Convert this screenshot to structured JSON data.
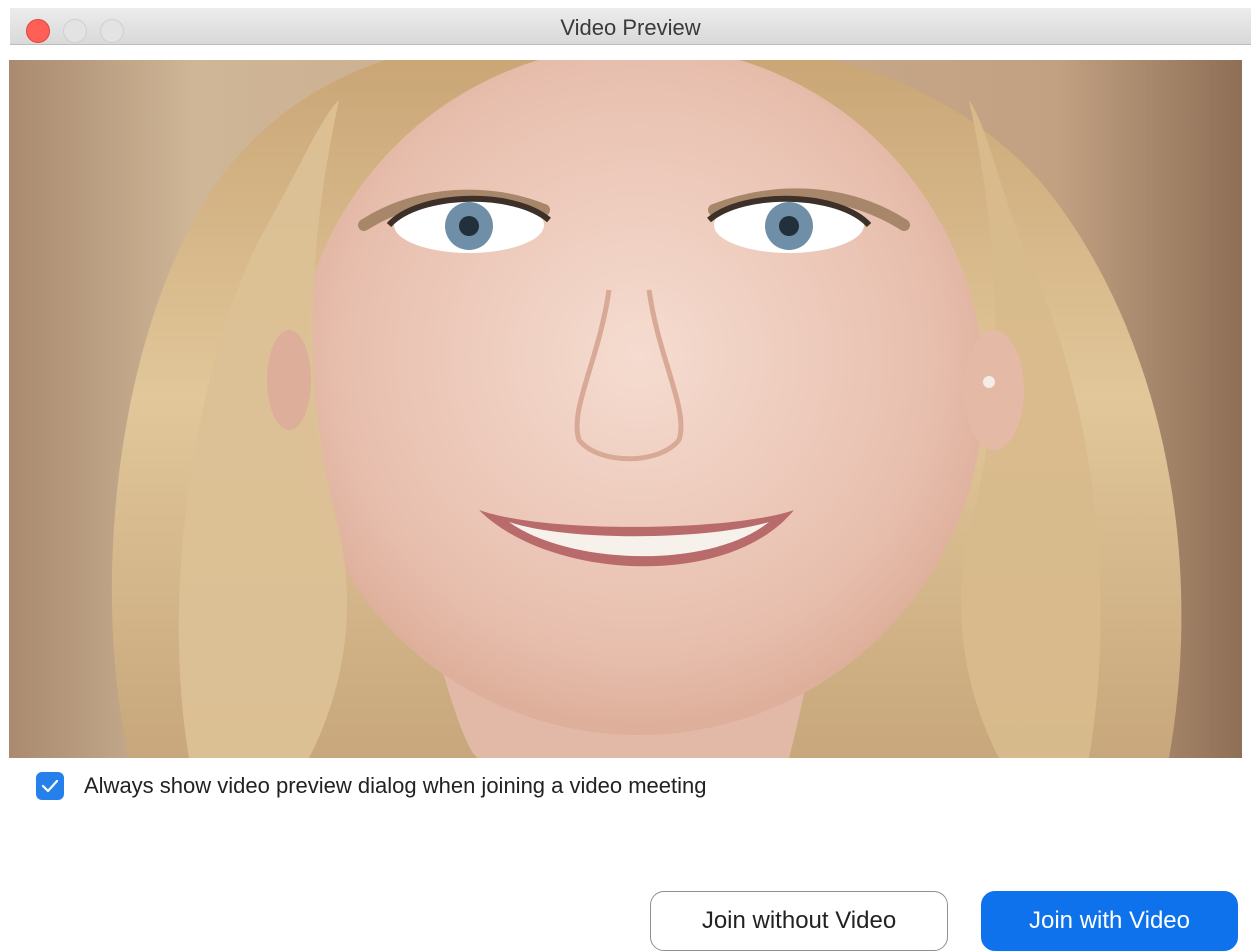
{
  "window": {
    "title": "Video Preview",
    "controls": [
      "close",
      "minimize",
      "zoom"
    ]
  },
  "preview": {
    "content": "camera-video-feed"
  },
  "preference": {
    "checked": true,
    "label": "Always show video preview dialog when joining a video meeting"
  },
  "actions": {
    "join_without_video": "Join without Video",
    "join_with_video": "Join with Video"
  },
  "colors": {
    "accent": "#0e72ed",
    "checkbox": "#2680eb",
    "close_button": "#fe5f57"
  }
}
